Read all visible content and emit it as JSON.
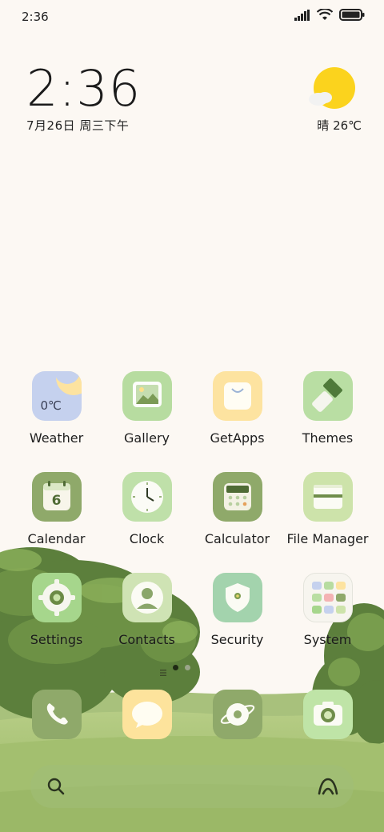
{
  "status_bar": {
    "time": "2:36",
    "icons": [
      "signal-icon",
      "wifi-icon",
      "battery-icon"
    ]
  },
  "clock_widget": {
    "time": "2:36",
    "date": "7月26日 周三下午"
  },
  "weather_widget": {
    "condition_temp": "晴 26℃",
    "icon": "sun-cloud-icon"
  },
  "apps": [
    {
      "label": "Weather",
      "icon": "weather-icon",
      "tile_text": "0℃",
      "color": "#c5d1ee"
    },
    {
      "label": "Gallery",
      "icon": "gallery-icon",
      "color": "#b7dca0"
    },
    {
      "label": "GetApps",
      "icon": "getapps-icon",
      "color": "#fde3a0"
    },
    {
      "label": "Themes",
      "icon": "themes-icon",
      "color": "#b9dea3"
    },
    {
      "label": "Calendar",
      "icon": "calendar-icon",
      "tile_text": "6",
      "color": "#8fa96a"
    },
    {
      "label": "Clock",
      "icon": "clock-icon",
      "color": "#bfe0a9"
    },
    {
      "label": "Calculator",
      "icon": "calculator-icon",
      "color": "#8fa96a"
    },
    {
      "label": "File Manager",
      "icon": "folder-icon",
      "color": "#cde3aa"
    },
    {
      "label": "Settings",
      "icon": "settings-icon",
      "color": "#a6d68c"
    },
    {
      "label": "Contacts",
      "icon": "contacts-icon",
      "color": "#cfe3b4"
    },
    {
      "label": "Security",
      "icon": "security-icon",
      "color": "#a3d3ad"
    },
    {
      "label": "System",
      "icon": "system-folder-icon",
      "color": "#f7f5ef"
    }
  ],
  "dock": [
    {
      "icon": "phone-icon",
      "color": "#8fa96a"
    },
    {
      "icon": "messages-icon",
      "color": "#fde39c"
    },
    {
      "icon": "browser-icon",
      "color": "#8fa96a"
    },
    {
      "icon": "camera-icon",
      "color": "#bfe4a7"
    }
  ],
  "page_indicator": {
    "pages": 2,
    "current": 1
  },
  "search_bar": {
    "left_icon": "search-icon",
    "right_icon": "assistant-icon"
  }
}
